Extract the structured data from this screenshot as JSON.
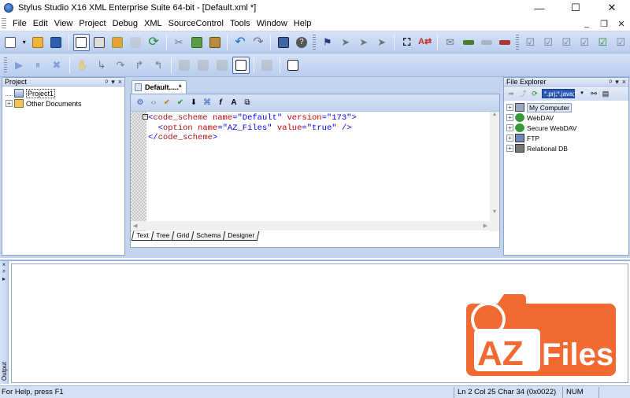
{
  "window": {
    "title": "Stylus Studio X16 XML Enterprise Suite 64-bit - [Default.xml *]",
    "minimize": "—",
    "maximize": "☐",
    "close": "✕"
  },
  "menu": {
    "items": [
      "File",
      "Edit",
      "View",
      "Project",
      "Debug",
      "XML",
      "SourceControl",
      "Tools",
      "Window",
      "Help"
    ],
    "mdi_minimize": "_",
    "mdi_restore": "❐",
    "mdi_close": "✕"
  },
  "project_panel": {
    "title": "Project",
    "controls": [
      "ᵖ",
      "▾",
      "×"
    ],
    "items": [
      {
        "label": "Project1",
        "icon": "project-icon"
      },
      {
        "label": "Other Documents",
        "icon": "documents-icon"
      }
    ]
  },
  "editor": {
    "tab_label": "Default.....*",
    "code_lines": [
      {
        "tag_open": "<",
        "tag": "code_scheme",
        "attrs": [
          {
            "name": "name",
            "value": "\"Default\""
          },
          {
            "name": "version",
            "value": "\"173\""
          }
        ],
        "tag_close": ">"
      },
      {
        "tag_open": "<",
        "tag": "option",
        "attrs": [
          {
            "name": "name",
            "value": "\"AZ_Files\""
          },
          {
            "name": "value",
            "value": "\"true\""
          }
        ],
        "tag_close": " />"
      },
      {
        "tag_open": "</",
        "tag": "code_scheme",
        "attrs": [],
        "tag_close": ">"
      }
    ],
    "view_tabs": [
      "Text",
      "Tree",
      "Grid",
      "Schema",
      "Designer"
    ],
    "active_view": "Text"
  },
  "file_explorer": {
    "title": "File Explorer",
    "controls": [
      "ᵖ",
      "▾",
      "×"
    ],
    "filter_value": "*.prj;*.java;*",
    "items": [
      {
        "label": "My Computer",
        "icon": "computer-icon"
      },
      {
        "label": "WebDAV",
        "icon": "webdav-icon"
      },
      {
        "label": "Secure WebDAV",
        "icon": "secure-webdav-icon"
      },
      {
        "label": "FTP",
        "icon": "ftp-icon"
      },
      {
        "label": "Relational DB",
        "icon": "database-icon"
      }
    ]
  },
  "output_panel": {
    "label": "Output",
    "controls": [
      "×",
      "ᵖ",
      "▸"
    ]
  },
  "watermark": {
    "text_az": "AZ",
    "text_files": "Files",
    "color_orange": "#f26a32",
    "color_white": "#ffffff"
  },
  "statusbar": {
    "help": "For Help, press F1",
    "position": "Ln 2 Col 25  Char 34 (0x0022)",
    "num": "NUM",
    "blank": ""
  },
  "colors": {
    "toolbar_bg": "#c8d8f2",
    "panel_bg": "#c4d4ef",
    "xml_tag": "#a31515",
    "xml_attr": "#c00000",
    "xml_value": "#0000ff"
  }
}
